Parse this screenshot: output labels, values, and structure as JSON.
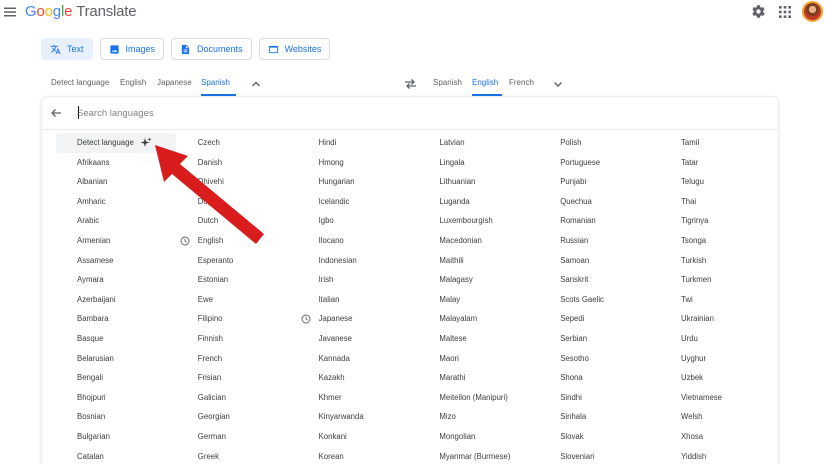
{
  "header": {
    "logo_parts": [
      "G",
      "o",
      "o",
      "g",
      "l",
      "e"
    ],
    "product": "Translate"
  },
  "icons": {
    "menu": "menu-icon",
    "settings": "gear-icon",
    "apps": "apps-grid-icon",
    "swap": "swap-arrows-icon",
    "back": "back-arrow-icon",
    "detect_sparkle": "sparkle-icon",
    "recent": "history-icon"
  },
  "modes": [
    {
      "label": "Text",
      "icon": "translate-icon"
    },
    {
      "label": "Images",
      "icon": "image-icon"
    },
    {
      "label": "Documents",
      "icon": "document-icon"
    },
    {
      "label": "Websites",
      "icon": "globe-icon"
    }
  ],
  "source_langs": [
    "Detect language",
    "English",
    "Japanese",
    "Spanish"
  ],
  "target_langs": [
    "Spanish",
    "English",
    "French"
  ],
  "search": {
    "placeholder": "Search languages"
  },
  "languages": [
    "Detect language",
    "Afrikaans",
    "Albanian",
    "Amharic",
    "Arabic",
    "Armenian",
    "Assamese",
    "Aymara",
    "Azerbaijani",
    "Bambara",
    "Basque",
    "Belarusian",
    "Bengali",
    "Bhojpuri",
    "Bosnian",
    "Bulgarian",
    "Catalan",
    "Czech",
    "Danish",
    "Dhivehi",
    "Dogri",
    "Dutch",
    "English",
    "Esperanto",
    "Estonian",
    "Ewe",
    "Filipino",
    "Finnish",
    "French",
    "Frisian",
    "Galician",
    "Georgian",
    "German",
    "Greek",
    "Hindi",
    "Hmong",
    "Hungarian",
    "Icelandic",
    "Igbo",
    "Ilocano",
    "Indonesian",
    "Irish",
    "Italian",
    "Japanese",
    "Javanese",
    "Kannada",
    "Kazakh",
    "Khmer",
    "Kinyarwanda",
    "Konkani",
    "Korean",
    "Latvian",
    "Lingala",
    "Lithuanian",
    "Luganda",
    "Luxembourgish",
    "Macedonian",
    "Maithili",
    "Malagasy",
    "Malay",
    "Malayalam",
    "Maltese",
    "Maori",
    "Marathi",
    "Meiteilon (Manipuri)",
    "Mizo",
    "Mongolian",
    "Myanmar (Burmese)",
    "Polish",
    "Portuguese",
    "Punjabi",
    "Quechua",
    "Romanian",
    "Russian",
    "Samoan",
    "Sanskrit",
    "Scots Gaelic",
    "Sepedi",
    "Serbian",
    "Sesotho",
    "Shona",
    "Sindhi",
    "Sinhala",
    "Slovak",
    "Slovenian",
    "Tamil",
    "Tatar",
    "Telugu",
    "Thai",
    "Tigrinya",
    "Tsonga",
    "Turkish",
    "Turkmen",
    "Twi",
    "Ukrainian",
    "Urdu",
    "Uyghur",
    "Uzbek",
    "Vietnamese",
    "Welsh",
    "Xhosa",
    "Yiddish"
  ],
  "colors": {
    "accent": "#1a73e8",
    "annotation_arrow": "#d91c1c"
  }
}
